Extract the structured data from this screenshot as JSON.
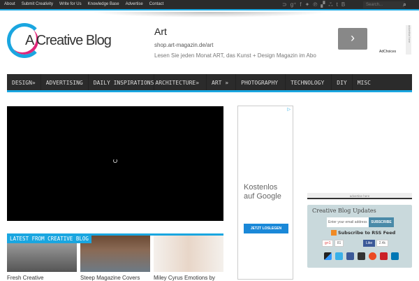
{
  "topbar": {
    "links": [
      "About",
      "Submit Creativity",
      "Write for Us",
      "Knowledge Base",
      "Advertise",
      "Contact"
    ],
    "social_icons": [
      "rss-icon",
      "google-plus-icon",
      "facebook-icon",
      "twitter-icon",
      "pinterest-icon",
      "delicious-icon",
      "stumbleupon-icon",
      "tumblr-icon",
      "blogger-icon"
    ],
    "search_placeholder": "Search..."
  },
  "logo": {
    "text": "A Creative Blog"
  },
  "banner_ad": {
    "title": "Art",
    "url": "shop.art-magazin.de/art",
    "description": "Lesen Sie jeden Monat ART, das Kunst + Design Magazin im Abo",
    "adchoices": "AdChoices",
    "advertise": "advertise here"
  },
  "nav": [
    "DESIGN»",
    "ADVERTISING",
    "DAILY INSPIRATIONS",
    "ARCHITECTURE»",
    "ART »",
    "PHOTOGRAPHY",
    "TECHNOLOGY",
    "DIY",
    "MISC"
  ],
  "latest": {
    "label": "LATEST FROM CREATIVE BLOG",
    "items": [
      "Fresh Creative",
      "Steep Magazine Covers",
      "Miley Cyrus Emotions by"
    ]
  },
  "side_ad": {
    "text1": "Kostenlos",
    "text2": "auf Google",
    "button": "JETZT LOSLEGEN"
  },
  "sidebar": {
    "advertise": "advertise here",
    "title": "Creative Blog Updates",
    "email_placeholder": "Enter your email address",
    "subscribe": "SUBSCRIBE",
    "rss": "Subscribe to RSS Feed",
    "gplus": "g+1",
    "gplus_count": "81",
    "fb_like": "Like",
    "fb_count": "2.4k"
  }
}
